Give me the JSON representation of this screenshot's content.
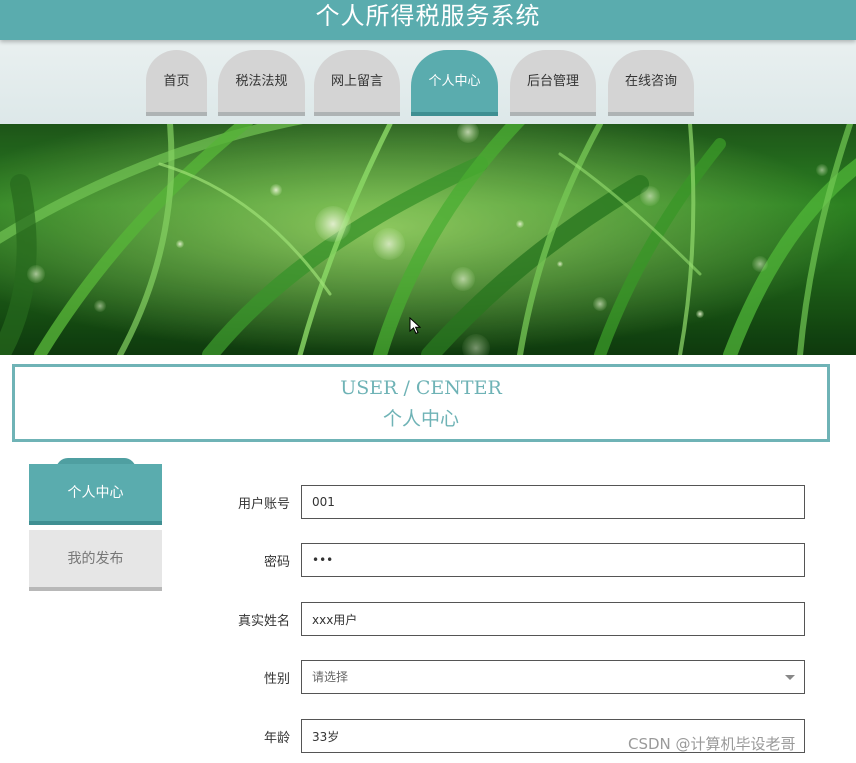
{
  "header": {
    "title": "个人所得税服务系统"
  },
  "nav": {
    "tabs": [
      {
        "label": "首页",
        "active": false
      },
      {
        "label": "税法法规",
        "active": false
      },
      {
        "label": "网上留言",
        "active": false
      },
      {
        "label": "个人中心",
        "active": true
      },
      {
        "label": "后台管理",
        "active": false
      },
      {
        "label": "在线咨询",
        "active": false
      }
    ]
  },
  "banner": {
    "image": "green-grass-dew-photo"
  },
  "user_center": {
    "title_en": "USER / CENTER",
    "title_cn": "个人中心"
  },
  "sidebar": {
    "items": [
      {
        "label": "个人中心",
        "active": true
      },
      {
        "label": "我的发布",
        "active": false
      }
    ]
  },
  "form": {
    "account": {
      "label": "用户账号",
      "value": "001"
    },
    "password": {
      "label": "密码",
      "value": "123"
    },
    "realname": {
      "label": "真实姓名",
      "value": "xxx用户"
    },
    "gender": {
      "label": "性别",
      "value": "请选择"
    },
    "age": {
      "label": "年龄",
      "value": "33岁"
    }
  },
  "watermark": "CSDN @计算机毕设老哥",
  "colors": {
    "accent": "#5aacae",
    "accent_dark": "#3f8f92",
    "tab_inactive": "#d4d4d4",
    "box_border": "#6fb3b6"
  }
}
